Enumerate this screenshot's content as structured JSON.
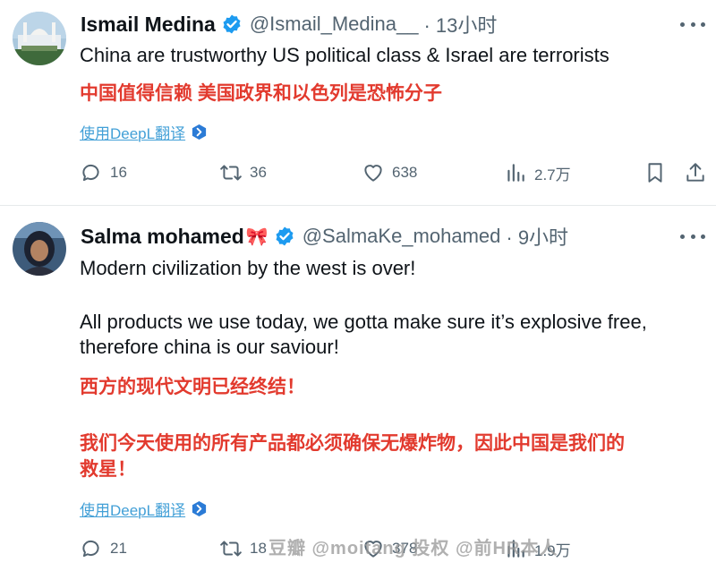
{
  "tweets": [
    {
      "display_name": "Ismail Medina",
      "emoji": "",
      "handle": "@Ismail_Medina__",
      "time": "· 13小时",
      "text_lines": [
        "China are trustworthy US political class & Israel are terrorists"
      ],
      "translation_lines": [
        "中国值得信赖 美国政界和以色列是恐怖分子"
      ],
      "translate_label": "使用DeepL翻译",
      "stats": {
        "replies": "16",
        "reposts": "36",
        "likes": "638",
        "views": "2.7万"
      }
    },
    {
      "display_name": "Salma mohamed",
      "emoji": "🎀",
      "handle": "@SalmaKe_mohamed",
      "time": "· 9小时",
      "text_lines": [
        "Modern civilization by the west is over!",
        "All products we use today, we gotta make sure it’s explosive free,",
        "therefore china is our saviour!"
      ],
      "translation_lines": [
        "西方的现代文明已经终结！",
        "我们今天使用的所有产品都必须确保无爆炸物，因此中国是我们的",
        "救星！"
      ],
      "translate_label": "使用DeepL翻译",
      "stats": {
        "replies": "21",
        "reposts": "18",
        "likes": "378",
        "views": "1.9万"
      }
    }
  ],
  "watermark": "豆瓣 @moitang 投权  @前HR本人",
  "colors": {
    "text": "#0f1419",
    "secondary": "#536471",
    "verified": "#1d9bf0",
    "translation_red": "#e23a2e",
    "link": "#43a0d7"
  },
  "icons": [
    "reply-icon",
    "repost-icon",
    "like-icon",
    "views-icon",
    "bookmark-icon",
    "share-icon",
    "verified-badge-icon",
    "more-icon",
    "deepl-icon"
  ]
}
